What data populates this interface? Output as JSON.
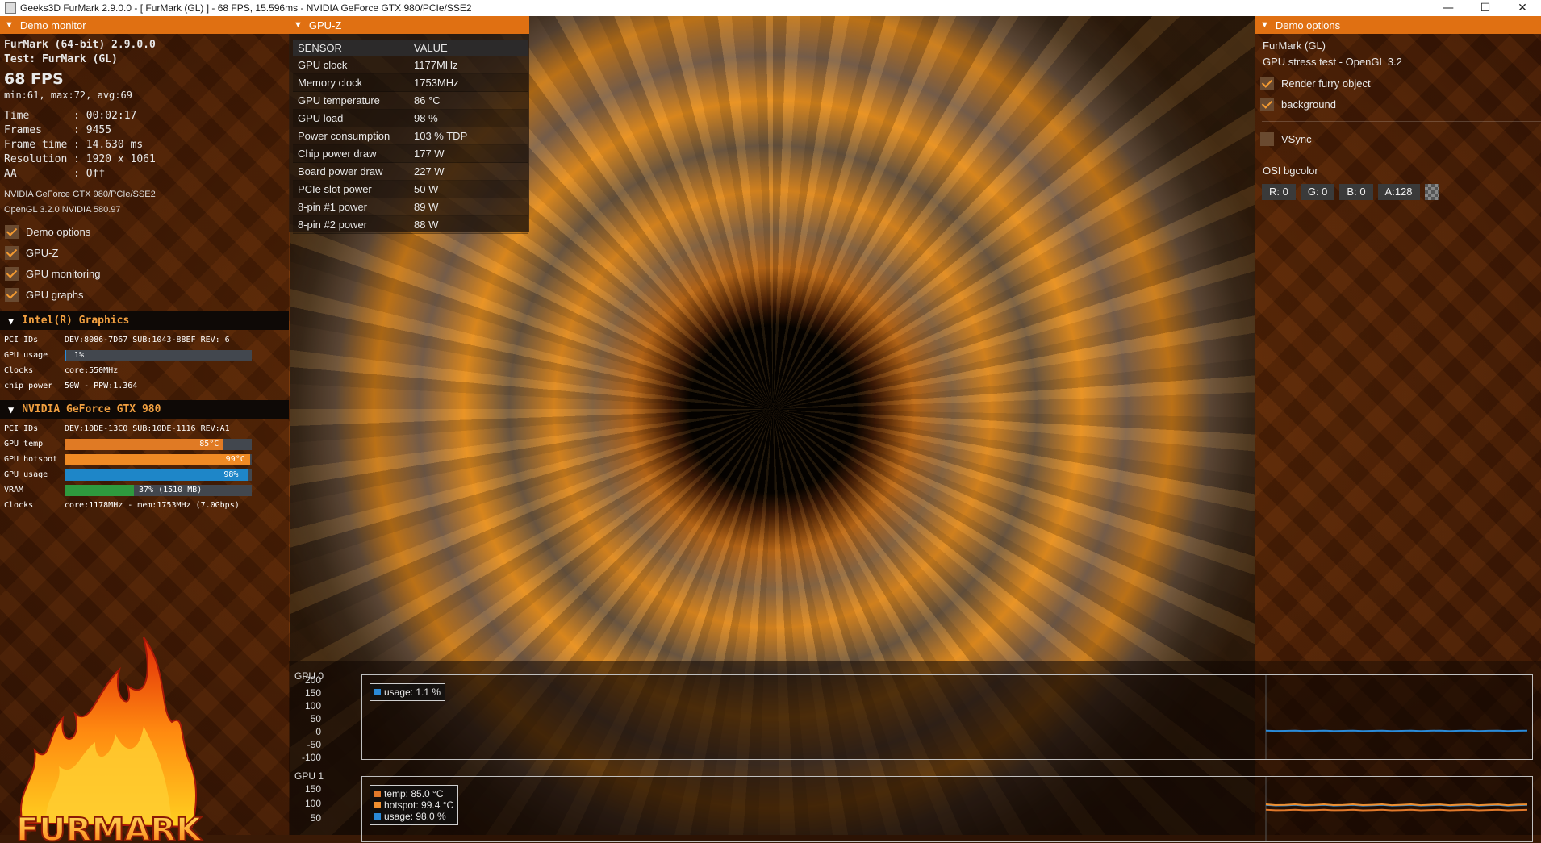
{
  "window": {
    "title": "Geeks3D FurMark 2.9.0.0 - [ FurMark (GL) ] - 68 FPS, 15.596ms - NVIDIA GeForce GTX 980/PCIe/SSE2",
    "minimize_glyph": "—",
    "maximize_glyph": "☐",
    "close_glyph": "✕"
  },
  "demo_monitor": {
    "header": "Demo monitor",
    "app_version": "FurMark (64-bit) 2.9.0.0",
    "test": "Test: FurMark (GL)",
    "fps": "68 FPS",
    "fps_stats": "min:61, max:72, avg:69",
    "stats": [
      {
        "label": "Time       ",
        "value": ": 00:02:17"
      },
      {
        "label": "Frames     ",
        "value": ": 9455"
      },
      {
        "label": "Frame time ",
        "value": ": 14.630 ms"
      },
      {
        "label": "Resolution ",
        "value": ": 1920 x 1061"
      },
      {
        "label": "AA         ",
        "value": ": Off"
      }
    ],
    "renderer": "NVIDIA GeForce GTX 980/PCIe/SSE2",
    "opengl": "OpenGL 3.2.0 NVIDIA 580.97",
    "toggles": [
      {
        "label": "Demo options",
        "checked": true
      },
      {
        "label": "GPU-Z",
        "checked": true
      },
      {
        "label": "GPU monitoring",
        "checked": true
      },
      {
        "label": "GPU graphs",
        "checked": true
      }
    ],
    "gpu0": {
      "name": "Intel(R) Graphics",
      "pci_label": "PCI IDs",
      "pci_value": "DEV:8086-7D67 SUB:1043-88EF REV: 6",
      "usage_label": "GPU usage",
      "usage_text": "1%",
      "usage_fraction": 0.01,
      "clocks_label": "Clocks",
      "clocks_value": "core:550MHz",
      "power_label": "chip power",
      "power_value": "50W - PPW:1.364"
    },
    "gpu1": {
      "name": "NVIDIA GeForce GTX 980",
      "pci_label": "PCI IDs",
      "pci_value": "DEV:10DE-13C0 SUB:10DE-1116 REV:A1",
      "temp_label": "GPU temp",
      "temp_text": "85°C",
      "temp_fraction": 0.85,
      "hotspot_label": "GPU hotspot",
      "hotspot_text": "99°C",
      "hotspot_fraction": 0.99,
      "usage_label": "GPU usage",
      "usage_text": "98%",
      "usage_fraction": 0.98,
      "vram_label": "VRAM",
      "vram_text": "37% (1510 MB)",
      "vram_fraction": 0.37,
      "clocks_label": "Clocks",
      "clocks_value": "core:1178MHz - mem:1753MHz (7.0Gbps)"
    },
    "logo_text": "FURMARK"
  },
  "gpuz": {
    "header": "GPU-Z",
    "col_sensor": "SENSOR",
    "col_value": "VALUE",
    "rows": [
      {
        "sensor": "GPU clock",
        "value": "1177MHz"
      },
      {
        "sensor": "Memory clock",
        "value": "1753MHz"
      },
      {
        "sensor": "GPU temperature",
        "value": "86 °C"
      },
      {
        "sensor": "GPU load",
        "value": "98 %"
      },
      {
        "sensor": "Power consumption",
        "value": "103 % TDP"
      },
      {
        "sensor": "Chip power draw",
        "value": "177 W"
      },
      {
        "sensor": "Board power draw",
        "value": "227 W"
      },
      {
        "sensor": "PCIe slot power",
        "value": "50 W"
      },
      {
        "sensor": "8-pin #1 power",
        "value": "89 W"
      },
      {
        "sensor": "8-pin #2 power",
        "value": "88 W"
      }
    ]
  },
  "demo_options": {
    "header": "Demo options",
    "name": "FurMark (GL)",
    "description": "GPU stress test - OpenGL 3.2",
    "render_furry": {
      "label": "Render furry object",
      "checked": true
    },
    "background": {
      "label": "background",
      "checked": true
    },
    "vsync": {
      "label": "VSync",
      "checked": false
    },
    "osi_label": "OSI bgcolor",
    "color_fields": [
      "R: 0",
      "G: 0",
      "B: 0",
      "A:128"
    ]
  },
  "graphs": {
    "gpu0": {
      "title": "GPU 0",
      "y_ticks": [
        "200",
        "150",
        "100",
        "50",
        "0",
        "-50",
        "-100"
      ],
      "legend": [
        {
          "label": "usage: 1.1 %",
          "color": "#2a8ad8"
        }
      ],
      "usage": 1.1
    },
    "gpu1": {
      "title": "GPU 1",
      "y_ticks": [
        "150",
        "100",
        "50"
      ],
      "legend": [
        {
          "label": "temp: 85.0 °C",
          "color": "#e0782a"
        },
        {
          "label": "hotspot: 99.4 °C",
          "color": "#f09030"
        },
        {
          "label": "usage: 98.0 %",
          "color": "#2a8ad8"
        }
      ],
      "temp": 85.0,
      "hotspot": 99.4,
      "usage": 98.0
    }
  }
}
